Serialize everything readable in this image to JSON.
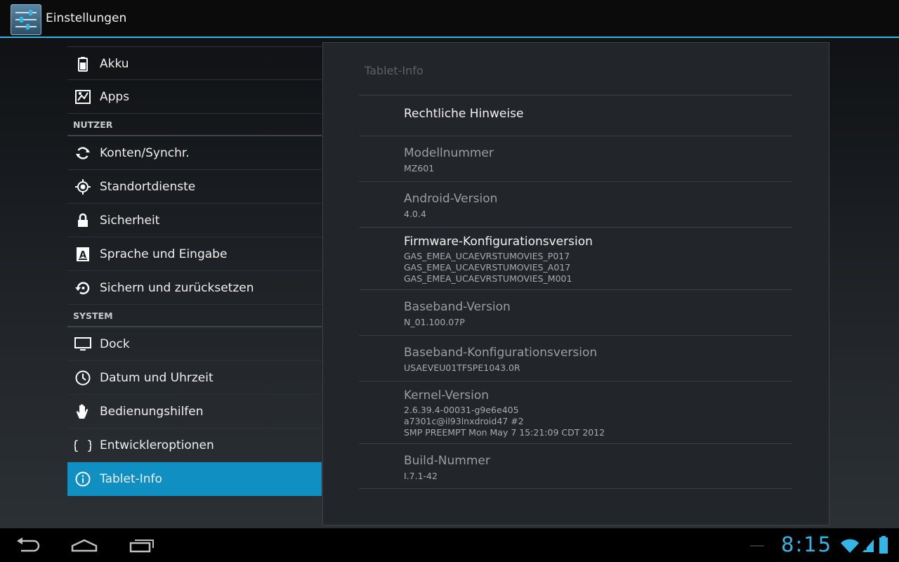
{
  "actionbar": {
    "title": "Einstellungen",
    "icon": "settings-sliders-icon"
  },
  "sidebar": {
    "items_top": [
      {
        "label": "Akku",
        "icon": "battery-icon"
      },
      {
        "label": "Apps",
        "icon": "apps-icon"
      }
    ],
    "header_user": "NUTZER",
    "items_user": [
      {
        "label": "Konten/Synchr.",
        "icon": "sync-icon"
      },
      {
        "label": "Standortdienste",
        "icon": "location-icon"
      },
      {
        "label": "Sicherheit",
        "icon": "lock-icon"
      },
      {
        "label": "Sprache und Eingabe",
        "icon": "language-icon"
      },
      {
        "label": "Sichern und zurücksetzen",
        "icon": "backup-icon"
      }
    ],
    "header_system": "SYSTEM",
    "items_system": [
      {
        "label": "Dock",
        "icon": "dock-icon"
      },
      {
        "label": "Datum und Uhrzeit",
        "icon": "clock-icon"
      },
      {
        "label": "Bedienungshilfen",
        "icon": "hand-icon"
      },
      {
        "label": "Entwickleroptionen",
        "icon": "braces-icon"
      },
      {
        "label": "Tablet-Info",
        "icon": "info-icon",
        "selected": true
      }
    ]
  },
  "panel": {
    "title": "Tablet-Info",
    "legal": "Rechtliche Hinweise",
    "model_title": "Modellnummer",
    "model_value": "MZ601",
    "android_title": "Android-Version",
    "android_value": "4.0.4",
    "firmware_title": "Firmware-Konfigurationsversion",
    "firmware_lines": [
      "GAS_EMEA_UCAEVRSTUMOVIES_P017",
      "GAS_EMEA_UCAEVRSTUMOVIES_A017",
      "GAS_EMEA_UCAEVRSTUMOVIES_M001"
    ],
    "baseband_title": "Baseband-Version",
    "baseband_value": "N_01.100.07P",
    "baseband_cfg_title": "Baseband-Konfigurationsversion",
    "baseband_cfg_value": "USAEVEU01TFSPE1043.0R",
    "kernel_title": "Kernel-Version",
    "kernel_lines": [
      "2.6.39.4-00031-g9e6e405",
      "a7301c@il93lnxdroid47 #2",
      "SMP PREEMPT Mon May 7 15:21:09 CDT 2012"
    ],
    "build_title": "Build-Nummer",
    "build_value": "I.7.1-42"
  },
  "navbar": {
    "back_icon": "back-icon",
    "home_icon": "home-icon",
    "recents_icon": "recents-icon",
    "time": "8:15",
    "colors": {
      "accent": "#33b5e5",
      "selected": "#0f8fc2"
    }
  }
}
